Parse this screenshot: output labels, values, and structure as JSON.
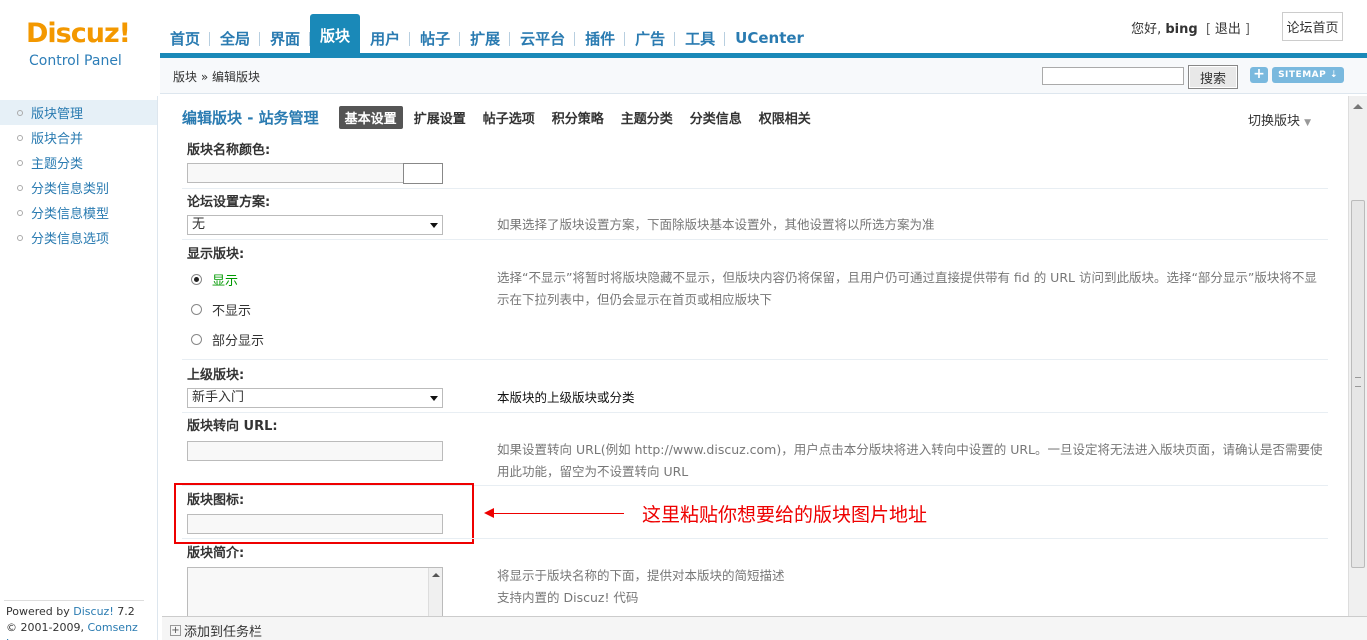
{
  "logo": {
    "brand": "Discuz!",
    "sub": "Control Panel"
  },
  "nav": {
    "tabs": [
      "首页",
      "全局",
      "界面",
      "版块",
      "用户",
      "帖子",
      "扩展",
      "云平台",
      "插件",
      "广告",
      "工具",
      "UCenter"
    ],
    "active_index": 3
  },
  "user": {
    "greeting": "您好,",
    "name": "bing",
    "logout": "退出",
    "forum_home": "论坛首页"
  },
  "breadcrumb": "版块 » 编辑版块",
  "search": {
    "value": "",
    "button": "搜索",
    "sitemap": "SITEMAP"
  },
  "sidebar": {
    "items": [
      "版块管理",
      "版块合并",
      "主题分类",
      "分类信息类别",
      "分类信息模型",
      "分类信息选项"
    ],
    "powered_line1": "Powered by ",
    "powered_brand": "Discuz! ",
    "powered_version": "7.2",
    "copyright": "© 2001-2009, ",
    "company": "Comsenz Inc."
  },
  "main": {
    "title": "编辑版块 - 站务管理",
    "tabs": [
      "基本设置",
      "扩展设置",
      "帖子选项",
      "积分策略",
      "主题分类",
      "分类信息",
      "权限相关"
    ],
    "switch_forum": "切换版块",
    "color_label": "版块名称颜色:",
    "scheme_label": "论坛设置方案:",
    "scheme_value": "无",
    "scheme_hint": "如果选择了版块设置方案，下面除版块基本设置外，其他设置将以所选方案为准",
    "display_label": "显示版块:",
    "display_options": [
      "显示",
      "不显示",
      "部分显示"
    ],
    "display_hint": "选择“不显示”将暂时将版块隐藏不显示，但版块内容仍将保留，且用户仍可通过直接提供带有 fid 的 URL 访问到此版块。选择“部分显示”版块将不显示在下拉列表中，但仍会显示在首页或相应版块下",
    "parent_label": "上级版块:",
    "parent_value": "新手入门",
    "parent_hint": "本版块的上级版块或分类",
    "redirect_label": "版块转向 URL:",
    "redirect_hint": "如果设置转向 URL(例如 http://www.discuz.com)，用户点击本分版块将进入转向中设置的 URL。一旦设定将无法进入版块页面，请确认是否需要使用此功能，留空为不设置转向 URL",
    "icon_label": "版块图标:",
    "annotation": "这里粘贴你想要给的版块图片地址",
    "intro_label": "版块简介:",
    "intro_hint1": "将显示于版块名称的下面，提供对本版块的简短描述",
    "intro_hint2": "支持内置的 Discuz! 代码"
  },
  "taskbar": {
    "label": "添加到任务栏"
  },
  "colors": {
    "accent": "#1a89b8",
    "link": "#2a7bb1",
    "logo": "#f39800",
    "annotation": "#ee0000"
  }
}
